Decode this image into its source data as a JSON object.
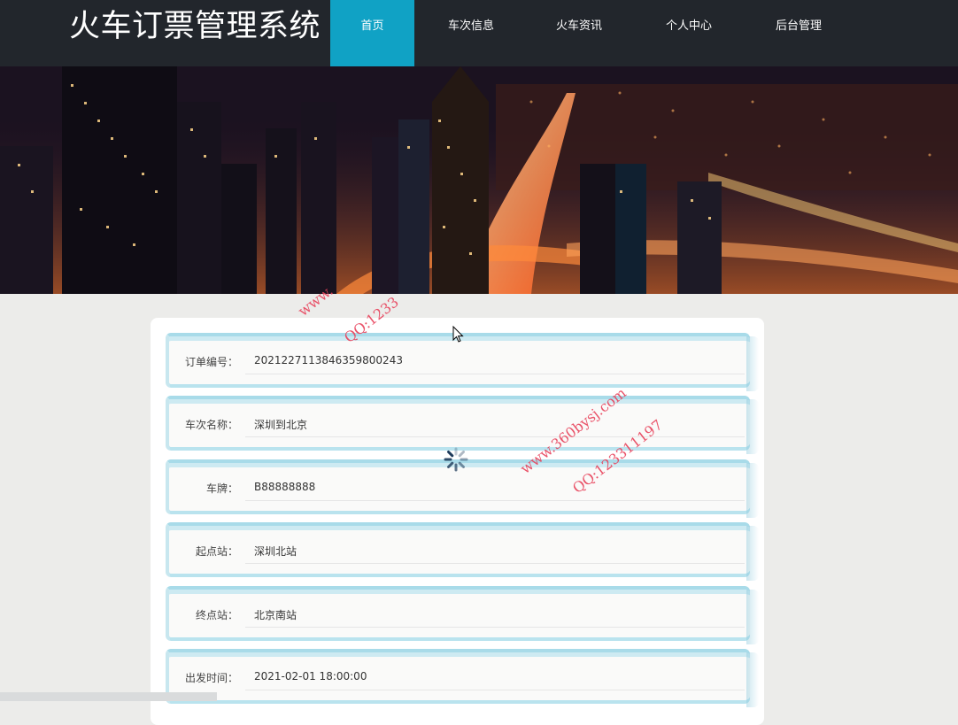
{
  "app": {
    "title": "火车订票管理系统"
  },
  "nav": {
    "items": [
      {
        "label": "首页",
        "active": true
      },
      {
        "label": "车次信息",
        "active": false
      },
      {
        "label": "火车资讯",
        "active": false
      },
      {
        "label": "个人中心",
        "active": false
      },
      {
        "label": "后台管理",
        "active": false
      }
    ]
  },
  "order": {
    "rows": [
      {
        "label": "订单编号：",
        "value": "2021227113846359800243"
      },
      {
        "label": "车次名称：",
        "value": "深圳到北京"
      },
      {
        "label": "车牌：",
        "value": "B88888888"
      },
      {
        "label": "起点站：",
        "value": "深圳北站"
      },
      {
        "label": "终点站：",
        "value": "北京南站"
      },
      {
        "label": "出发时间：",
        "value": "2021-02-01 18:00:00"
      }
    ]
  },
  "watermarks": [
    "www.360bysj.com",
    "QQ:123311197",
    "www.",
    "QQ:1233"
  ],
  "colors": {
    "header_bg": "#22262c",
    "nav_active": "#10a2c5",
    "page_bg": "#ececea",
    "watermark": "#e8415a"
  },
  "icons": {
    "spinner": "loading-spinner-icon",
    "cursor": "mouse-cursor-icon"
  }
}
